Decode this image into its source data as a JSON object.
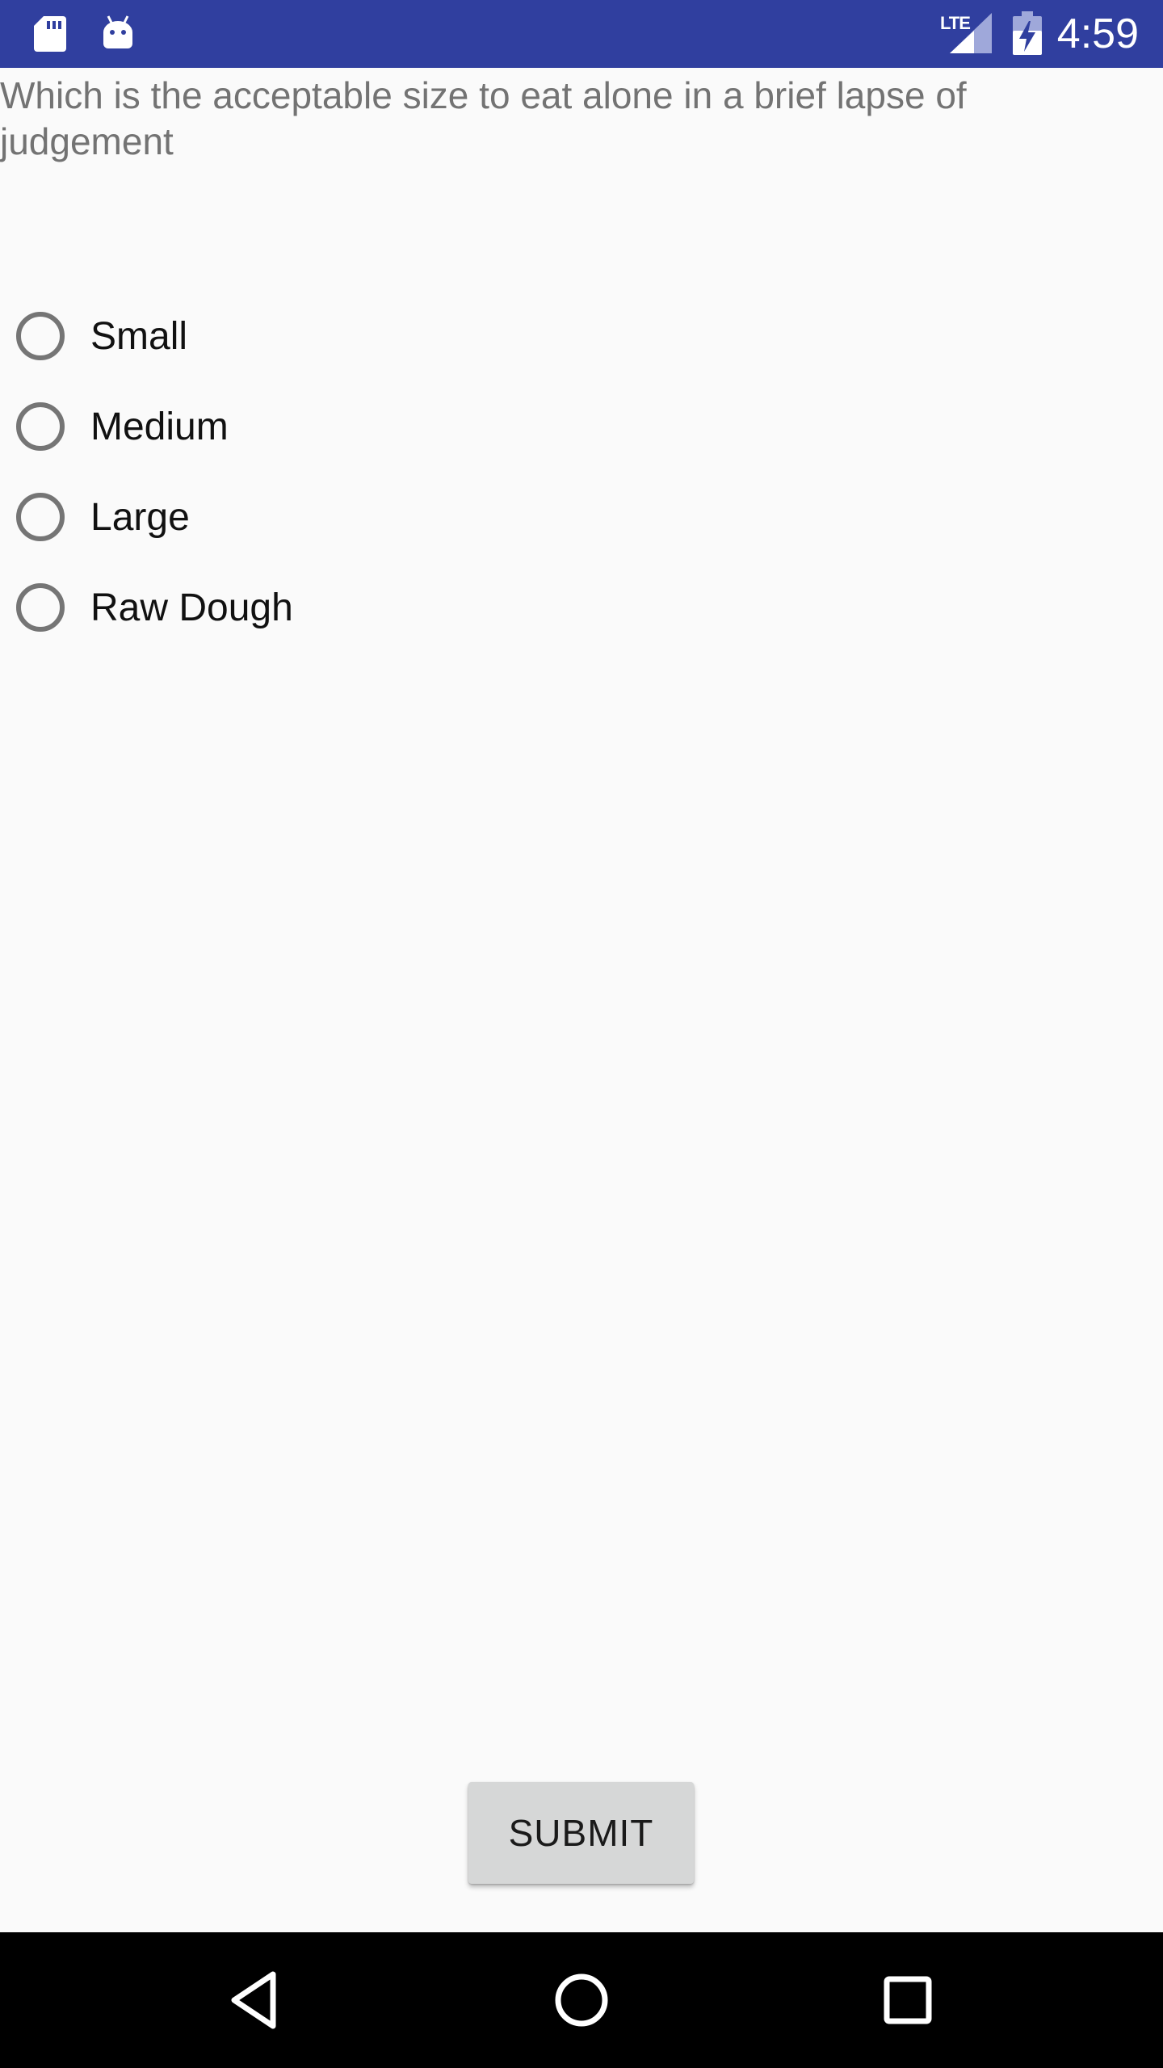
{
  "status_bar": {
    "time": "4:59",
    "network_label": "LTE",
    "icons": [
      "sd-card-icon",
      "android-debug-icon",
      "signal-icon",
      "battery-charging-icon"
    ]
  },
  "question": {
    "text": "Which is the acceptable size to eat alone in a brief lapse of judgement"
  },
  "options": [
    {
      "label": "Small",
      "selected": false
    },
    {
      "label": "Medium",
      "selected": false
    },
    {
      "label": "Large",
      "selected": false
    },
    {
      "label": "Raw Dough",
      "selected": false
    }
  ],
  "submit": {
    "label": "SUBMIT"
  },
  "nav_bar": {
    "icons": [
      "back-icon",
      "home-icon",
      "recent-apps-icon"
    ]
  },
  "colors": {
    "status_bar": "#303f9f",
    "background": "#fafafa",
    "question_text": "#737373",
    "radio_ring": "#757575",
    "button": "#d6d7d7",
    "nav_bar": "#000000"
  }
}
